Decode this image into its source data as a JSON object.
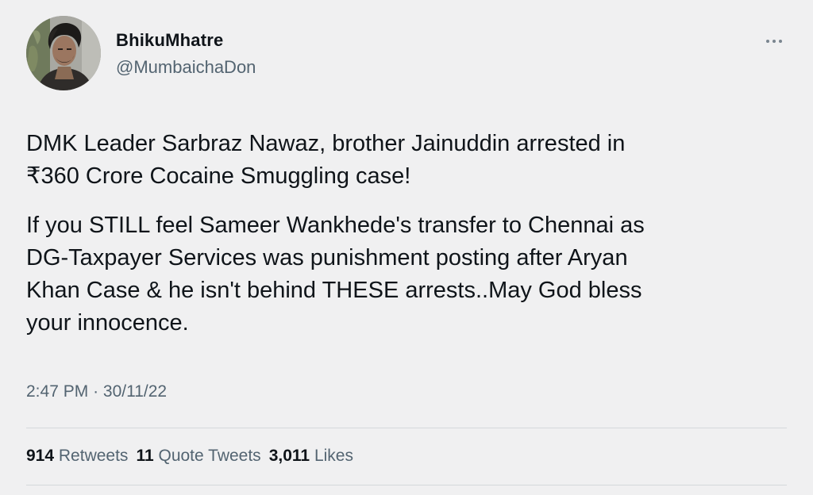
{
  "tweet": {
    "author": {
      "name": "BhikuMhatre",
      "handle": "@MumbaichaDon"
    },
    "paragraphs": [
      "DMK Leader Sarbraz Nawaz, brother Jainuddin arrested in\n₹360 Crore Cocaine Smuggling case!",
      "If you STILL feel Sameer Wankhede's transfer to Chennai as\nDG-Taxpayer Services was punishment posting after Aryan\nKhan Case & he isn't behind THESE arrests..May God bless\nyour innocence."
    ],
    "time": "2:47 PM",
    "separator": "·",
    "date": "30/11/22",
    "stats": {
      "retweets": {
        "count": "914",
        "label": "Retweets"
      },
      "quotes": {
        "count": "11",
        "label": "Quote Tweets"
      },
      "likes": {
        "count": "3,011",
        "label": "Likes"
      }
    },
    "more_icon": "more-horizontal-icon"
  },
  "colors": {
    "background": "#f0f0f1",
    "text_primary": "#0f1419",
    "text_secondary": "#536471",
    "divider": "#d4d8db"
  }
}
